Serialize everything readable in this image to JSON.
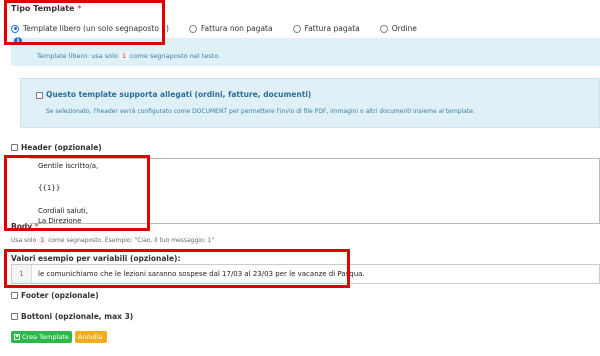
{
  "tipo_template": {
    "title": "Tipo Template",
    "required_mark": "*",
    "options": [
      {
        "label": "Template libero (un solo segnaposto 1)",
        "selected": true
      },
      {
        "label": "Fattura non pagata",
        "selected": false
      },
      {
        "label": "Fattura pagata",
        "selected": false
      },
      {
        "label": "Ordine",
        "selected": false
      }
    ]
  },
  "info": {
    "icon": "info-icon",
    "text_before": "Template libero: usa solo",
    "code": "1",
    "text_after": "come segnaposto nel testo."
  },
  "support": {
    "title": "Questo template supporta allegati (ordini, fatture, documenti)",
    "description": "Se selezionato, l'header verrà configurato come DOCUMENT per permettere l'invio di file PDF, immagini o altri documenti insieme al template."
  },
  "header": {
    "label": "Header (opzionale)"
  },
  "body": {
    "label": "Body",
    "required_mark": "*",
    "lines": [
      "Gentile iscritto/a,",
      "{{1}}",
      "Cordiali saluti,",
      "La Direzione"
    ],
    "help_before": "Usa solo",
    "help_code": "1",
    "help_after": "come segnaposto. Esempio: \"Ciao, il tuo messaggio: 1\""
  },
  "valori": {
    "label": "Valori esempio per variabili (opzionale):",
    "row_number": "1",
    "row_value": "le comunichiamo che le lezioni saranno sospese dal 17/03 al 23/03 per le vacanze di Pasqua."
  },
  "footer": {
    "label": "Footer (opzionale)"
  },
  "bottoni": {
    "label": "Bottoni (opzionale, max 3)"
  },
  "actions": {
    "create_label": "Crea Template",
    "cancel_label": "Annulla"
  },
  "colors": {
    "highlight": "#e00000",
    "info_bg": "#dff0f7",
    "primary": "#2a6ad8",
    "success": "#2db84a",
    "warning": "#f0ad1e"
  }
}
